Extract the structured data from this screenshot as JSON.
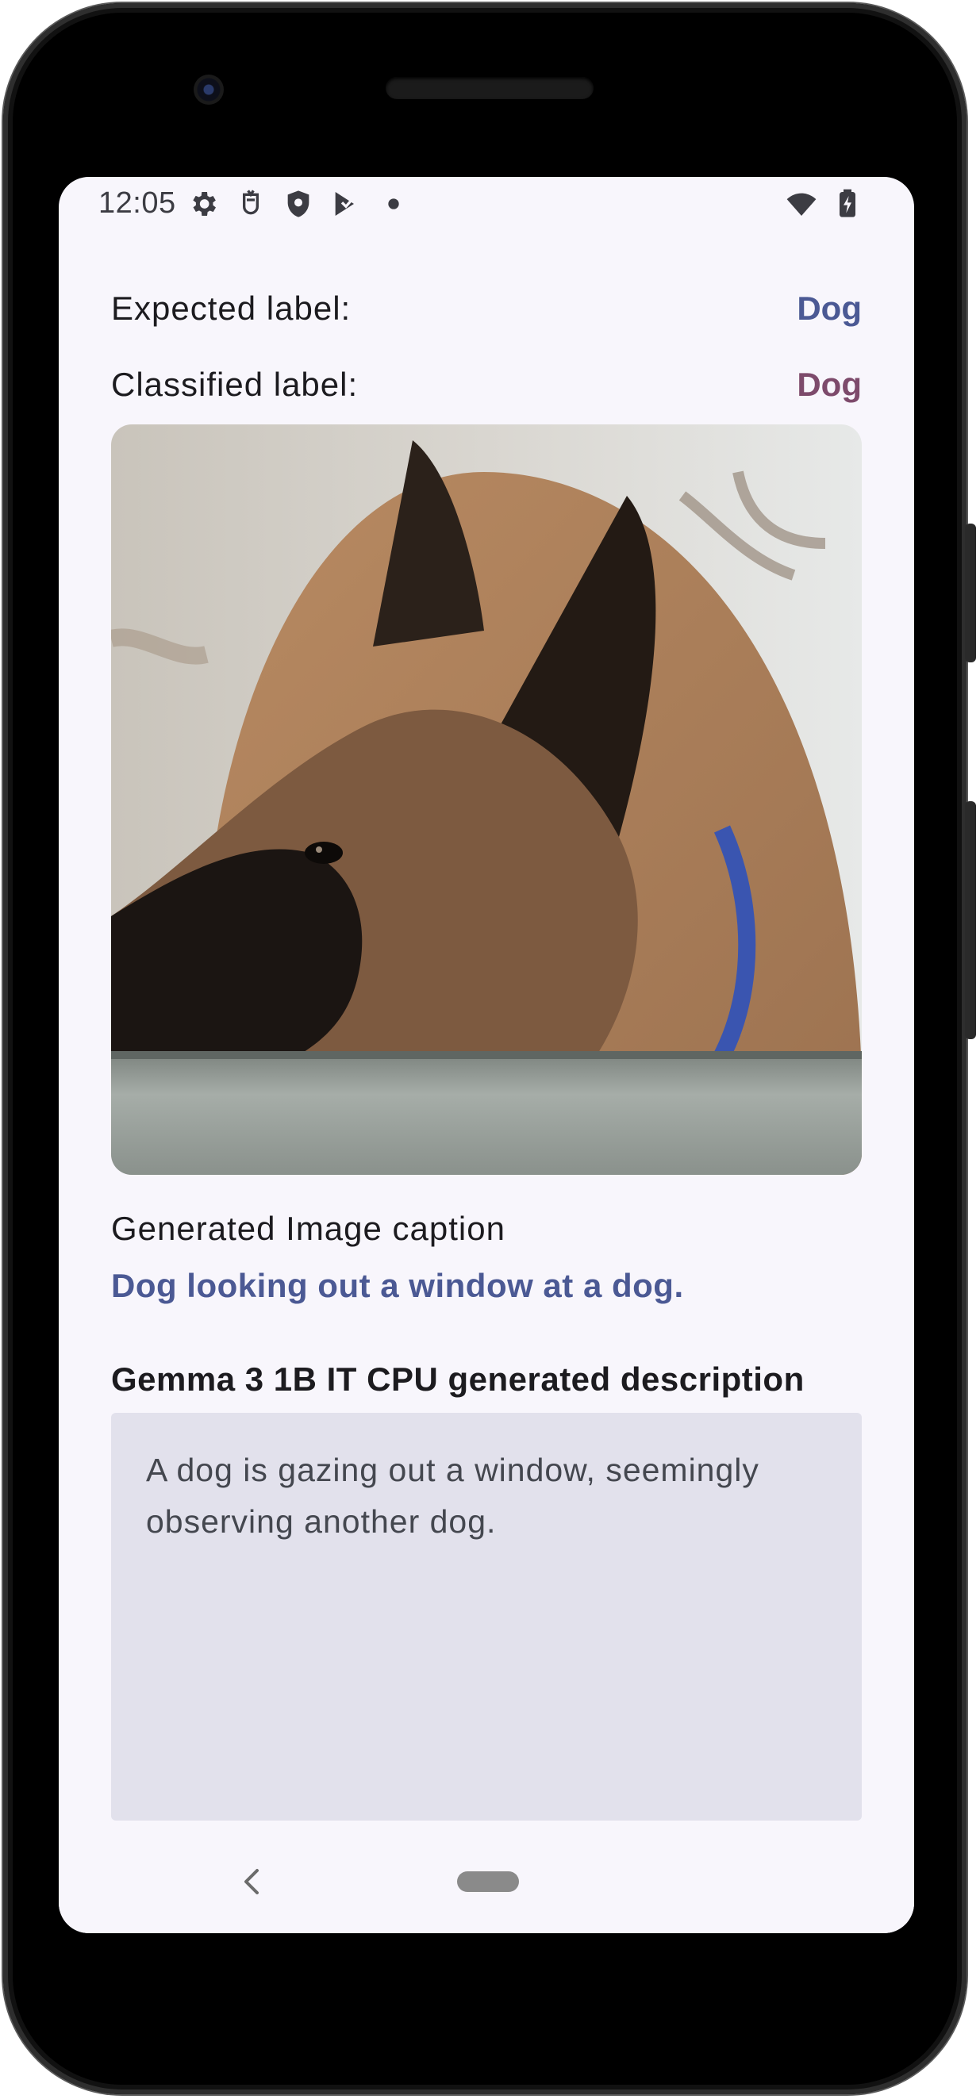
{
  "status_bar": {
    "time": "12:05",
    "icons": [
      "settings-gear-icon",
      "notification-app-icon",
      "shield-icon",
      "play-store-icon",
      "dot-icon",
      "wifi-icon",
      "battery-charging-icon"
    ]
  },
  "result": {
    "expected_label_title": "Expected label:",
    "expected_label_value": "Dog",
    "classified_label_title": "Classified label:",
    "classified_label_value": "Dog"
  },
  "caption": {
    "title": "Generated Image caption",
    "text": "Dog looking out a window at a dog."
  },
  "description": {
    "title": "Gemma 3 1B IT CPU generated description",
    "text": "A dog is gazing out a window, seemingly observing another dog."
  },
  "colors": {
    "screen_background": "#f8f6fc",
    "expected_value": "#4b5994",
    "classified_value": "#7d4a6b",
    "caption_text": "#4b5994",
    "description_box": "#e2e1ec"
  },
  "nav_bar": {
    "icons": [
      "back-chevron-icon",
      "home-pill-icon"
    ]
  }
}
